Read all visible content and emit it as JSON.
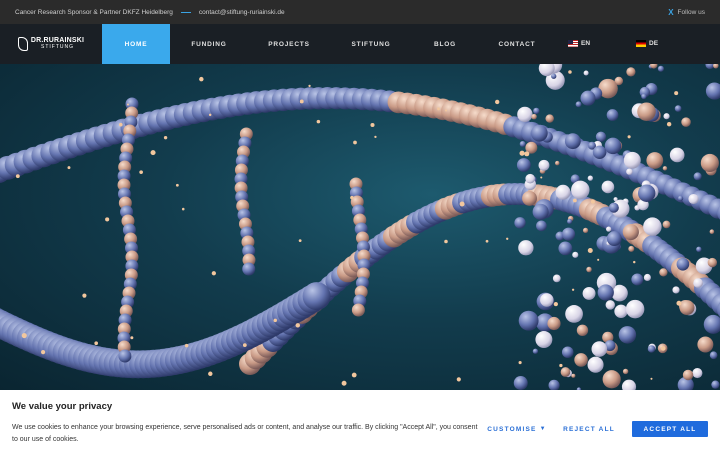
{
  "topbar": {
    "tagline": "Cancer Research Sponsor & Partner DKFZ Heidelberg",
    "email": "contact@stiftung-ruriainski.de",
    "follow_label": "Follow us",
    "x_icon_glyph": "X"
  },
  "logo": {
    "line1": "DR.RURAINSKI",
    "line2": "STIFTUNG"
  },
  "nav": {
    "items": [
      {
        "label": "HOME",
        "active": true
      },
      {
        "label": "FUNDING",
        "active": false
      },
      {
        "label": "PROJECTS",
        "active": false
      },
      {
        "label": "STIFTUNG",
        "active": false
      },
      {
        "label": "BLOG",
        "active": false
      },
      {
        "label": "CONTACT",
        "active": false
      }
    ],
    "lang_en": "EN",
    "lang_de": "DE"
  },
  "cookie": {
    "title": "We value your privacy",
    "text": "We use cookies to enhance your browsing experience, serve personalised ads or content, and analyse our traffic. By clicking \"Accept All\", you consent to our use of cookies.",
    "customise": "CUSTOMISE",
    "reject": "REJECT ALL",
    "accept": "ACCEPT ALL"
  },
  "colors": {
    "accent": "#3aa9ec",
    "button": "#1f6bdd",
    "topbar": "#2b2b2b"
  }
}
